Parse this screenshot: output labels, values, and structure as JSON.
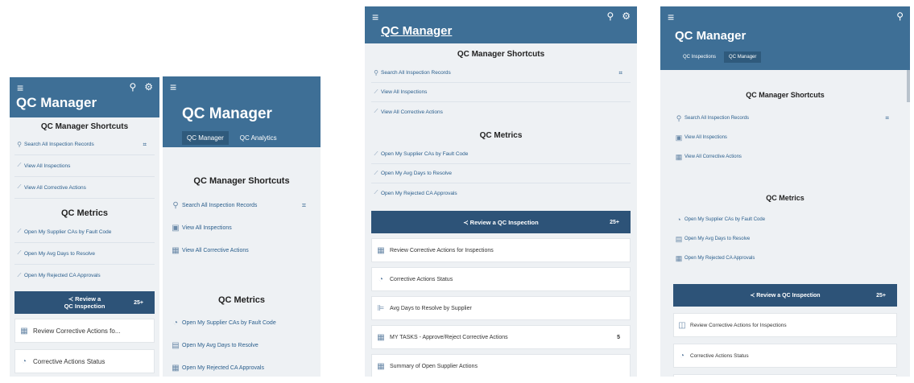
{
  "app": {
    "title": "QC Manager",
    "menu_icon": "hamburger-icon",
    "search_icon": "search-icon",
    "settings_icon": "gear-icon"
  },
  "tabs1": [
    "QC Manager",
    "QC Analytics"
  ],
  "tabs2": [
    "QC Inspections",
    "QC Manager"
  ],
  "shortcuts": {
    "title": "QC Manager Shortcuts",
    "search": "Search All Inspection Records",
    "inspections": "View All Inspections",
    "corrective": "View All Corrective Actions"
  },
  "metrics": {
    "title": "QC Metrics",
    "supplier": "Open My Supplier CAs by Fault Code",
    "avg": "Open My Avg Days to Resolve",
    "rejected": "Open My Rejected CA Approvals"
  },
  "banner": {
    "label": "Review a QC Inspection",
    "label_line1": "Review a",
    "label_line2": "QC Inspection",
    "count": "25+"
  },
  "cards": {
    "review": "Review Corrective Actions for Inspections",
    "review_trunc": "Review Corrective Actions fo...",
    "status": "Corrective Actions Status",
    "avgsupplier": "Avg Days to Resolve by Supplier",
    "mytasks": "MY TASKS - Approve/Reject Corrective Actions",
    "mytasks_count": "5",
    "summary": "Summary of Open Supplier Actions"
  }
}
